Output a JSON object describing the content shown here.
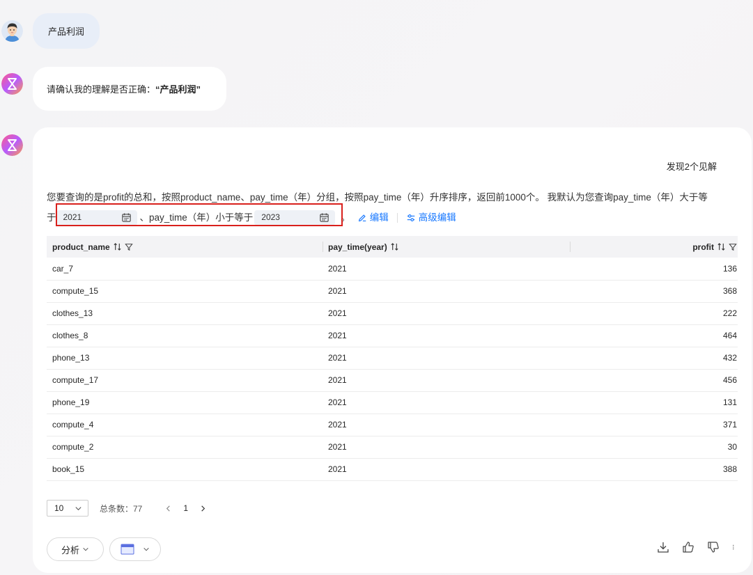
{
  "user_message": "产品利润",
  "confirm": {
    "prefix": "请确认我的理解是否正确：",
    "quoted": "“产品利润”"
  },
  "insight_label": "发现2个见解",
  "description": {
    "line1": "您要查询的是profit的总和，按照product_name、pay_time（年）分组，按照pay_time（年）升序排序，返回前1000个。 我默认为您查询pay_time（年）大于等",
    "yu": "于",
    "from_value": "2021",
    "mid": "、pay_time（年）小于等于",
    "to_value": "2023",
    "end": "。",
    "edit_label": "编辑",
    "adv_edit_label": "高级编辑"
  },
  "table": {
    "headers": [
      "product_name",
      "pay_time(year)",
      "profit"
    ],
    "rows": [
      [
        "car_7",
        "2021",
        "136"
      ],
      [
        "compute_15",
        "2021",
        "368"
      ],
      [
        "clothes_13",
        "2021",
        "222"
      ],
      [
        "clothes_8",
        "2021",
        "464"
      ],
      [
        "phone_13",
        "2021",
        "432"
      ],
      [
        "compute_17",
        "2021",
        "456"
      ],
      [
        "phone_19",
        "2021",
        "131"
      ],
      [
        "compute_4",
        "2021",
        "371"
      ],
      [
        "compute_2",
        "2021",
        "30"
      ],
      [
        "book_15",
        "2021",
        "388"
      ]
    ]
  },
  "pagination": {
    "page_size": "10",
    "total": "总条数：77",
    "current_page": "1"
  },
  "bottom": {
    "analyze_label": "分析"
  },
  "colors": {
    "accent": "#1677ff",
    "highlight": "#d9201c",
    "user_bubble": "#e8eef8"
  }
}
